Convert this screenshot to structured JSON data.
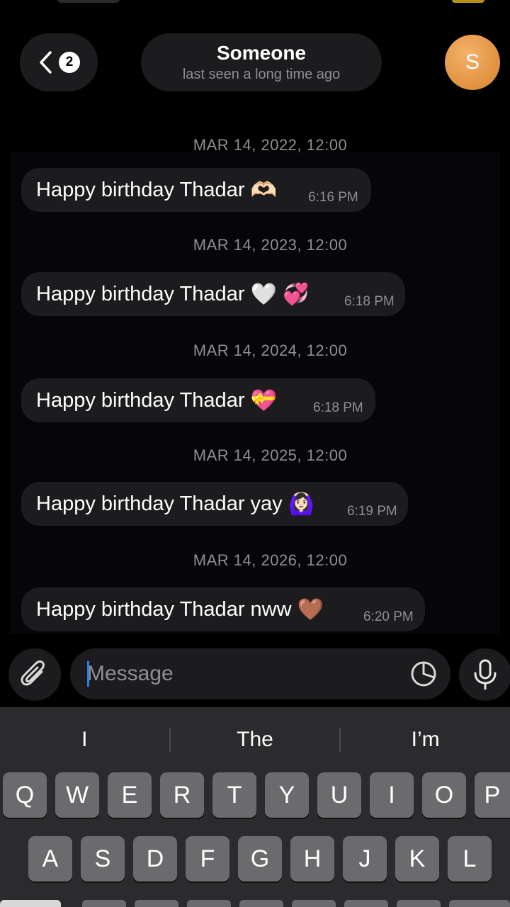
{
  "header": {
    "back_badge": "2",
    "contact_name": "Someone",
    "contact_status": "last seen a long time ago",
    "avatar_initial": "S",
    "avatar_color": "#e8953e"
  },
  "messages": [
    {
      "date": "MAR 14, 2022, 12:00",
      "text": "Happy birthday Thadar",
      "emoji": "🫶🏻",
      "time": "6:16 PM"
    },
    {
      "date": "MAR 14, 2023, 12:00",
      "text": "Happy birthday Thadar",
      "emoji": "🤍 💞",
      "time": "6:18 PM"
    },
    {
      "date": "MAR 14, 2024, 12:00",
      "text": "Happy birthday Thadar",
      "emoji": "💝",
      "time": "6:18 PM"
    },
    {
      "date": "MAR 14, 2025, 12:00",
      "text": "Happy birthday Thadar yay",
      "emoji": "🙆🏻‍♀️",
      "time": "6:19 PM"
    },
    {
      "date": "MAR 14, 2026, 12:00",
      "text": "Happy birthday Thadar nww",
      "emoji": "🤎",
      "time": "6:20 PM"
    }
  ],
  "composer": {
    "placeholder": "Message"
  },
  "keyboard": {
    "suggestions": [
      "I",
      "The",
      "I’m"
    ],
    "row1": [
      "Q",
      "W",
      "E",
      "R",
      "T",
      "Y",
      "U",
      "I",
      "O",
      "P"
    ],
    "row2": [
      "A",
      "S",
      "D",
      "F",
      "G",
      "H",
      "J",
      "K",
      "L"
    ]
  },
  "colors": {
    "background": "#000000",
    "bubble": "#1c1c1e",
    "accent": "#2f7bf6",
    "muted_text": "#8e8e93",
    "keyboard_bg": "#2b2b2d",
    "key_bg": "#6b6b6e"
  }
}
